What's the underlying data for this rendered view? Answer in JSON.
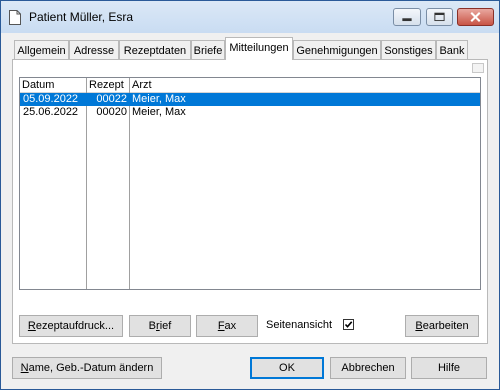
{
  "window": {
    "title": "Patient Müller, Esra"
  },
  "tabs": [
    {
      "label": "Allgemein"
    },
    {
      "label": "Adresse"
    },
    {
      "label": "Rezeptdaten"
    },
    {
      "label": "Briefe"
    },
    {
      "label": "Mitteilungen",
      "active": true
    },
    {
      "label": "Genehmigungen"
    },
    {
      "label": "Sonstiges"
    },
    {
      "label": "Bank"
    }
  ],
  "list": {
    "columns": [
      "Datum",
      "Rezept",
      "Arzt"
    ],
    "rows": [
      {
        "datum": "05.09.2022",
        "rezept": "00022",
        "arzt": "Meier, Max",
        "selected": true
      },
      {
        "datum": "25.06.2022",
        "rezept": "00020",
        "arzt": "Meier, Max",
        "selected": false
      }
    ]
  },
  "panel_buttons": {
    "rezeptaufdruck": {
      "mn": "R",
      "rest": "ezeptaufdruck..."
    },
    "brief": {
      "pre": "B",
      "mn": "r",
      "rest": "ief"
    },
    "fax": {
      "mn": "F",
      "rest": "ax"
    },
    "seitenansicht": {
      "label": "Seitenansicht",
      "checked": true
    },
    "bearbeiten": {
      "mn": "B",
      "rest": "earbeiten"
    }
  },
  "bottom_buttons": {
    "name": {
      "mn": "N",
      "rest": "ame, Geb.-Datum ändern"
    },
    "ok": {
      "label": "OK"
    },
    "abbrechen": {
      "label": "Abbrechen"
    },
    "hilfe": {
      "label": "Hilfe"
    }
  },
  "colors": {
    "selection": "#0078d7",
    "titlebar": "#c9dcf2"
  }
}
